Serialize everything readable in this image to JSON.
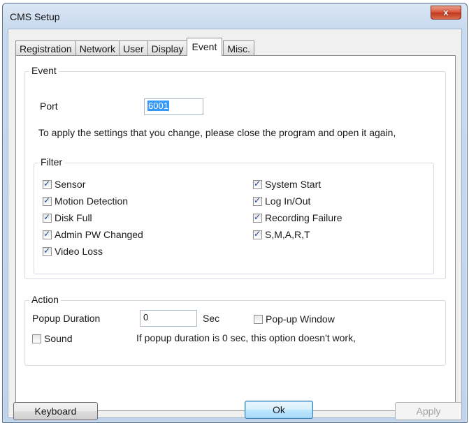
{
  "window": {
    "title": "CMS Setup",
    "close_glyph": "x"
  },
  "tabs": [
    {
      "label": "Registration"
    },
    {
      "label": "Network"
    },
    {
      "label": "User"
    },
    {
      "label": "Display"
    },
    {
      "label": "Event",
      "active": true
    },
    {
      "label": "Misc."
    }
  ],
  "event_group": {
    "label": "Event",
    "port_label": "Port",
    "port_value": "6001",
    "notice": "To apply the settings that you change, please close the program and open it again,"
  },
  "filter_group": {
    "label": "Filter",
    "left": [
      {
        "label": "Sensor",
        "checked": true
      },
      {
        "label": "Motion Detection",
        "checked": true
      },
      {
        "label": "Disk Full",
        "checked": true
      },
      {
        "label": "Admin PW Changed",
        "checked": true
      },
      {
        "label": "Video Loss",
        "checked": true
      }
    ],
    "right": [
      {
        "label": "System Start",
        "checked": true
      },
      {
        "label": "Log In/Out",
        "checked": true
      },
      {
        "label": "Recording Failure",
        "checked": true
      },
      {
        "label": "S,M,A,R,T",
        "checked": true
      }
    ]
  },
  "action_group": {
    "label": "Action",
    "popup_duration_label": "Popup Duration",
    "popup_duration_value": "0",
    "sec_label": "Sec",
    "popup_window_label": "Pop-up Window",
    "popup_window_checked": false,
    "sound_label": "Sound",
    "sound_checked": false,
    "popup_note": "If popup duration is 0 sec, this option doesn't work,"
  },
  "buttons": {
    "keyboard": "Keyboard",
    "ok": "Ok",
    "apply": "Apply"
  },
  "colors": {
    "selection": "#3399ff",
    "close_button": "#c9442a",
    "default_button": "#3c7fb1"
  }
}
